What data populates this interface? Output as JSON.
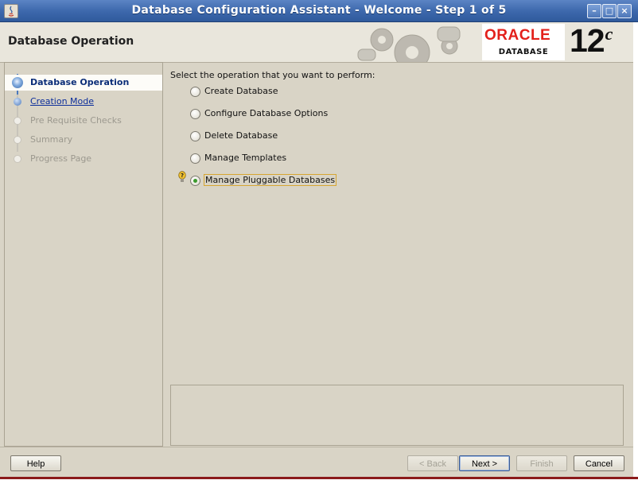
{
  "window": {
    "title": "Database Configuration Assistant - Welcome - Step 1 of 5",
    "controls": [
      "minimize",
      "maximize",
      "close"
    ]
  },
  "header": {
    "page_title": "Database Operation",
    "brand_name": "ORACLE",
    "brand_product": "DATABASE",
    "brand_version": "12",
    "brand_version_suffix": "c"
  },
  "steps": [
    {
      "label": "Database Operation",
      "state": "current"
    },
    {
      "label": "Creation Mode",
      "state": "link"
    },
    {
      "label": "Pre Requisite Checks",
      "state": "disabled"
    },
    {
      "label": "Summary",
      "state": "disabled"
    },
    {
      "label": "Progress Page",
      "state": "disabled"
    }
  ],
  "content": {
    "instruction": "Select the operation that you want to perform:",
    "options": [
      {
        "label": "Create Database",
        "selected": false
      },
      {
        "label": "Configure Database Options",
        "selected": false
      },
      {
        "label": "Delete Database",
        "selected": false
      },
      {
        "label": "Manage Templates",
        "selected": false
      },
      {
        "label": "Manage Pluggable Databases",
        "selected": true
      }
    ],
    "description": ""
  },
  "buttons": {
    "help": "Help",
    "back": "< Back",
    "next": "Next >",
    "finish": "Finish",
    "cancel": "Cancel"
  },
  "colors": {
    "titlebar": "#3e69ad",
    "panel": "#d9d4c6",
    "oracle_red": "#e3201b",
    "link": "#0b2d9a"
  }
}
